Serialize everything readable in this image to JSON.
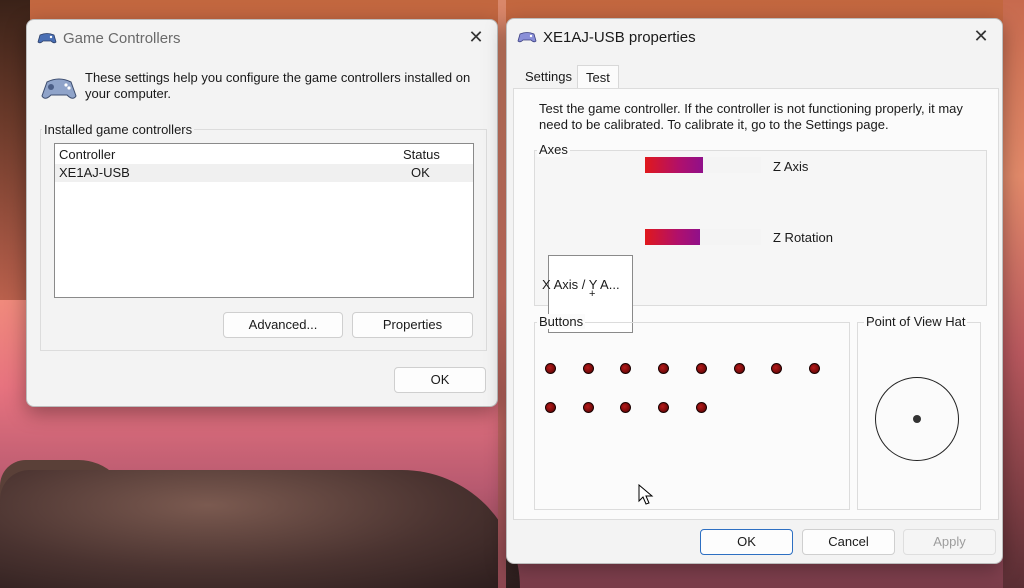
{
  "game_controllers": {
    "title": "Game Controllers",
    "description": "These settings help you configure the game controllers installed on your computer.",
    "group_label": "Installed game controllers",
    "columns": [
      "Controller",
      "Status"
    ],
    "rows": [
      {
        "controller": "XE1AJ-USB",
        "status": "OK"
      }
    ],
    "advanced_label": "Advanced...",
    "properties_label": "Properties",
    "ok_label": "OK"
  },
  "properties": {
    "title": "XE1AJ-USB properties",
    "tabs": [
      "Settings",
      "Test"
    ],
    "active_tab": "Test",
    "instructions": "Test the game controller.  If the controller is not functioning properly, it may need to be calibrated.  To calibrate it, go to the Settings page.",
    "axes_label": "Axes",
    "z_axis_label": "Z Axis",
    "z_axis_level": 0.5,
    "z_rotation_label": "Z Rotation",
    "z_rotation_level": 0.47,
    "xy_label": "X Axis / Y A...",
    "buttons_label": "Buttons",
    "button_count": 13,
    "pov_label": "Point of View Hat",
    "ok_label": "OK",
    "cancel_label": "Cancel",
    "apply_label": "Apply"
  },
  "colors": {
    "bar_start": "#e0181c",
    "bar_end": "#90108a",
    "button_dot": "#7a0b0b",
    "primary_border": "#2d6fc2"
  },
  "icons": {
    "controller": "gamepad-icon",
    "close": "close-icon",
    "cursor": "mouse-pointer-icon"
  }
}
